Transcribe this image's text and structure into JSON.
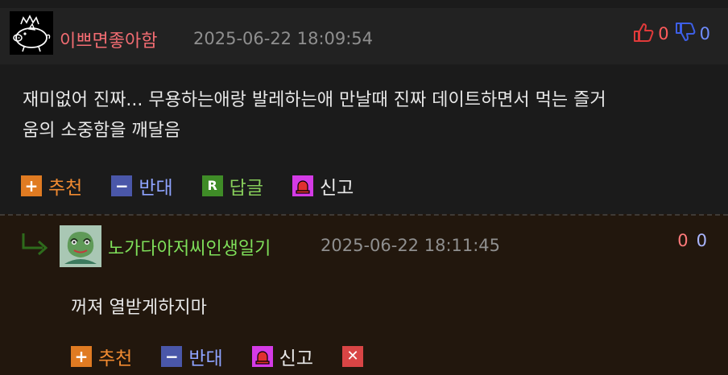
{
  "comment": {
    "author": "이쁘면좋아함",
    "timestamp": "2025-06-22 18:09:54",
    "upvotes": "0",
    "downvotes": "0",
    "body_line1": "재미없어 진짜... 무용하는애랑 발레하는애 만날때 진짜 데이트하면서 먹는 즐거",
    "body_line2": "움의 소중함을 깨달음",
    "actions": {
      "recommend": "추천",
      "oppose": "반대",
      "reply": "답글",
      "report": "신고"
    }
  },
  "reply": {
    "author": "노가다아저씨인생일기",
    "timestamp": "2025-06-22 18:11:45",
    "upvotes": "0",
    "downvotes": "0",
    "body": "꺼져 열받게하지마",
    "actions": {
      "recommend": "추천",
      "oppose": "반대",
      "report": "신고"
    }
  },
  "colors": {
    "nick_main": "#f26c72",
    "nick_reply": "#7fe05a",
    "recommend": "#e07b22",
    "oppose": "#4a57a9",
    "reply": "#3f8c27",
    "report": "#d43be6",
    "delete": "#d94545"
  },
  "icons": {
    "avatar_main": "pig-with-crown-avatar",
    "avatar_reply": "frog-bulbasaur-avatar",
    "thumb_up": "thumbs-up-icon",
    "thumb_down": "thumbs-down-icon",
    "reply_arrow": "reply-arrow-icon",
    "report": "siren-icon",
    "delete": "close-icon"
  }
}
